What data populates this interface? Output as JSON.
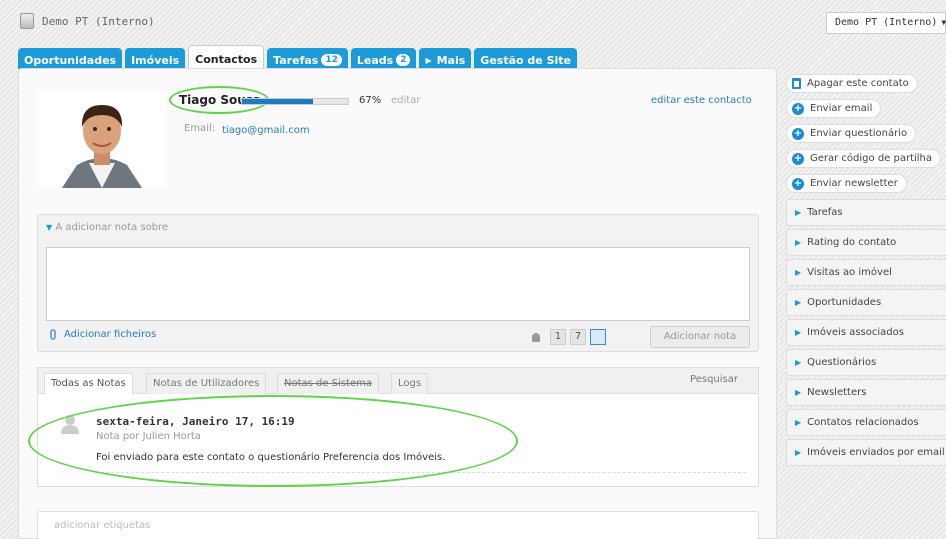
{
  "header": {
    "brand": "Demo PT (Interno)",
    "account_select": "Demo PT (Interno)"
  },
  "tabs": [
    {
      "label": "Oportunidades",
      "active": false,
      "badge": ""
    },
    {
      "label": "Imóveis",
      "active": false,
      "badge": ""
    },
    {
      "label": "Contactos",
      "active": true,
      "badge": ""
    },
    {
      "label": "Tarefas",
      "active": false,
      "badge": "12"
    },
    {
      "label": "Leads",
      "active": false,
      "badge": "2"
    },
    {
      "label": "Mais",
      "active": false,
      "badge": ""
    },
    {
      "label": "Gestão de Site",
      "active": false,
      "badge": ""
    }
  ],
  "contact": {
    "name": "Tiago Sousa",
    "completion_pct": 67,
    "completion_label": "67%",
    "edit_label": "editar",
    "email_label": "Email:",
    "email": "tiago@gmail.com",
    "edit_contact": "editar este contacto"
  },
  "note_form": {
    "header": "A adicionar nota sobre",
    "attach_label": "Adicionar ficheiros",
    "num1": "1",
    "num2": "7",
    "add_button": "Adicionar nota"
  },
  "notes": {
    "tabs": [
      "Todas as Notas",
      "Notas de Utilizadores",
      "Notas de Sistema",
      "Logs"
    ],
    "search": "Pesquisar",
    "item": {
      "date": "sexta-feira, Janeiro 17, 16:19",
      "author": "Nota por Julien Horta",
      "text": "Foi enviado para este contato o questionário Preferencia dos Imóveis."
    }
  },
  "tags": {
    "placeholder": "adicionar etiquetas"
  },
  "sidebar": {
    "actions": [
      {
        "label": "Apagar este contato",
        "icon": "trash-icon"
      },
      {
        "label": "Enviar email",
        "icon": "plus-icon"
      },
      {
        "label": "Enviar questionário",
        "icon": "plus-icon"
      },
      {
        "label": "Gerar código de partilha",
        "icon": "plus-icon"
      },
      {
        "label": "Enviar newsletter",
        "icon": "plus-icon"
      }
    ],
    "sections": [
      "Tarefas",
      "Rating do contato",
      "Visitas ao imóvel",
      "Oportunidades",
      "Imóveis associados",
      "Questionários",
      "Newsletters",
      "Contatos relacionados",
      "Imóveis enviados por email"
    ]
  },
  "colors": {
    "accent": "#1d9bd8",
    "highlight": "#5ed44a",
    "link": "#2b7bb8"
  }
}
